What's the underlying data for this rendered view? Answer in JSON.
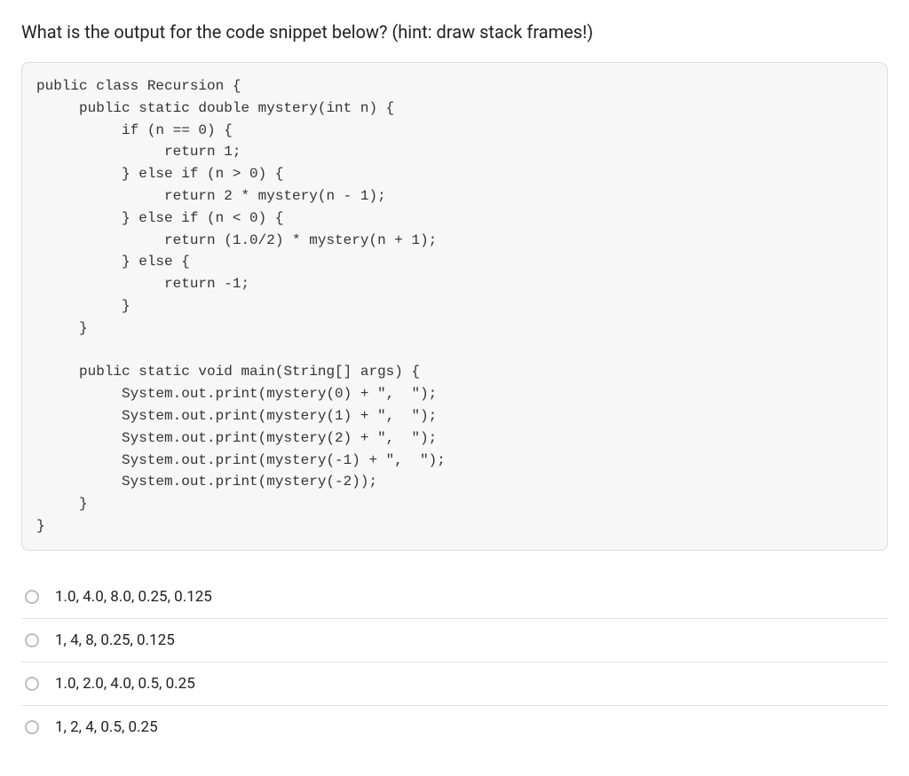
{
  "question": "What is the output for the code snippet below? (hint: draw stack frames!)",
  "code": "public class Recursion {\n     public static double mystery(int n) {\n          if (n == 0) {\n               return 1;\n          } else if (n > 0) {\n               return 2 * mystery(n - 1);\n          } else if (n < 0) {\n               return (1.0/2) * mystery(n + 1);\n          } else {\n               return -1;\n          }\n     }\n\n     public static void main(String[] args) {\n          System.out.print(mystery(0) + \",  \");\n          System.out.print(mystery(1) + \",  \");\n          System.out.print(mystery(2) + \",  \");\n          System.out.print(mystery(-1) + \",  \");\n          System.out.print(mystery(-2));\n     }\n}",
  "options": [
    {
      "label": "1.0, 4.0, 8.0, 0.25, 0.125"
    },
    {
      "label": "1, 4, 8, 0.25, 0.125"
    },
    {
      "label": "1.0, 2.0, 4.0, 0.5, 0.25"
    },
    {
      "label": "1, 2, 4, 0.5, 0.25"
    }
  ]
}
